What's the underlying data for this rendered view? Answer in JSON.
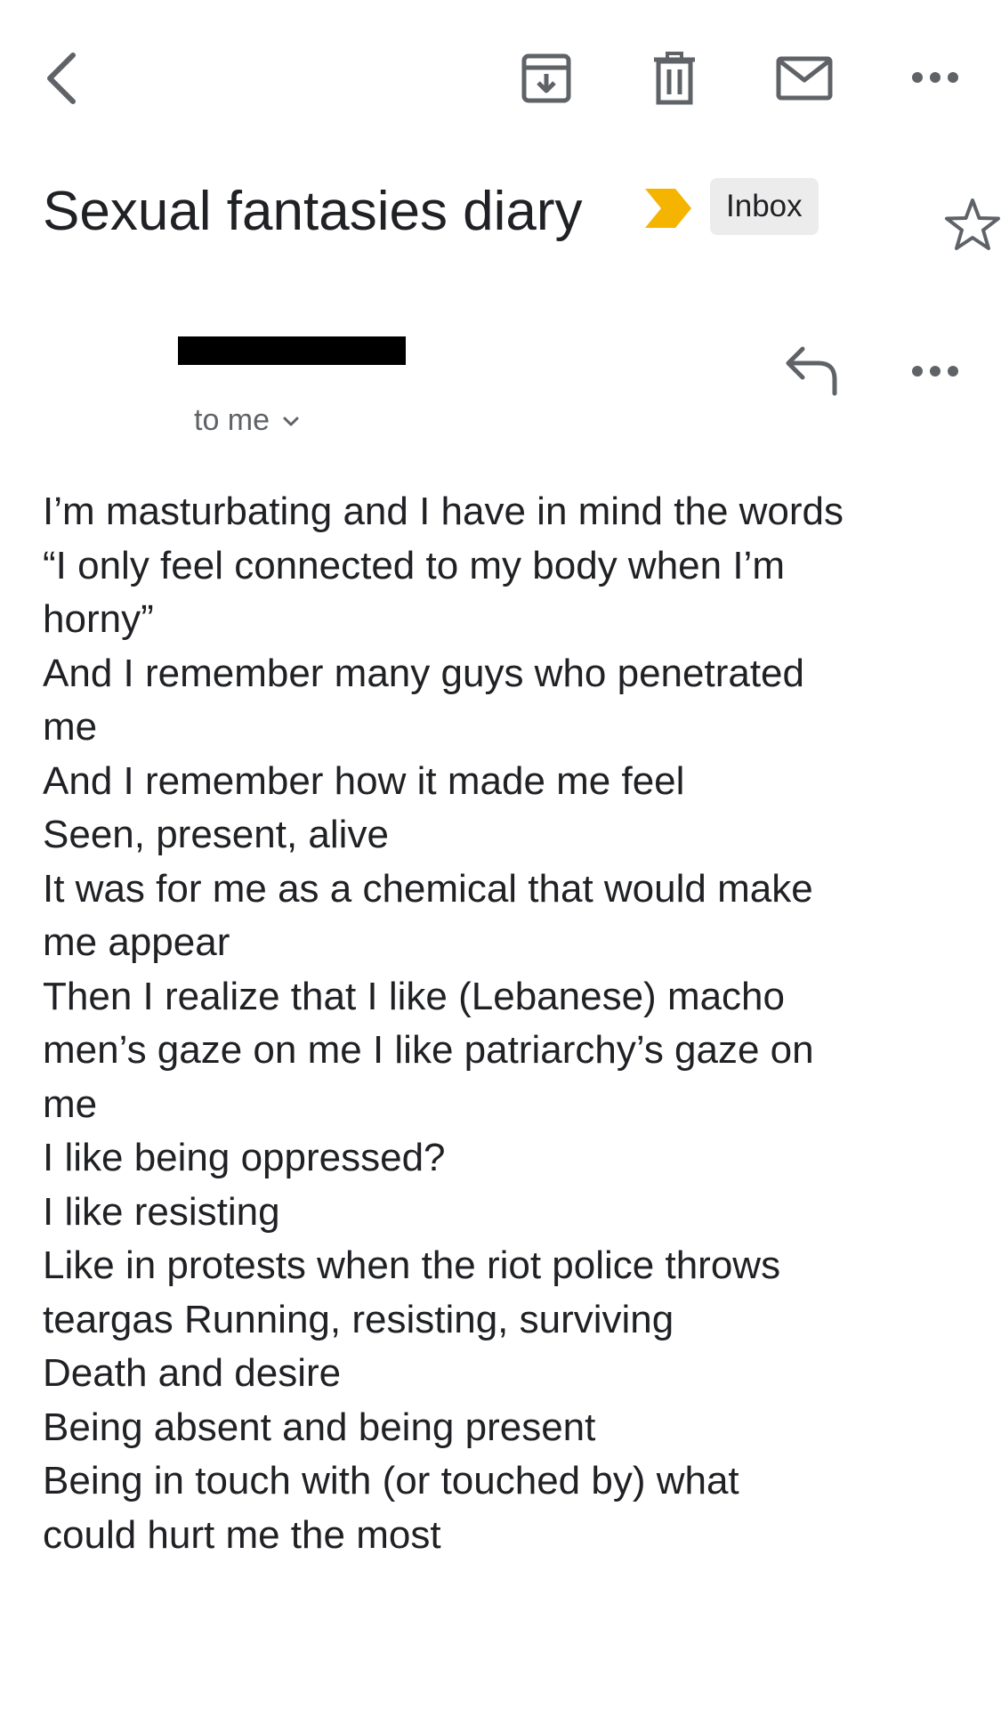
{
  "toolbar": {
    "back_icon": "chevron-left-icon",
    "archive_icon": "archive-icon",
    "delete_icon": "trash-icon",
    "mail_icon": "mail-icon",
    "more_icon": "more-horizontal-icon"
  },
  "email": {
    "subject": "Sexual fantasies diary",
    "importance_marker_color": "#F4B400",
    "label": "Inbox",
    "star_icon": "star-outline-icon",
    "sender_redacted": true,
    "recipient": "to me",
    "recipient_chevron_icon": "chevron-down-icon",
    "reply_icon": "reply-icon",
    "more_icon": "more-horizontal-icon",
    "body_lines": [
      "I’m masturbating and I have in mind the words",
      "“I only feel connected to my body when I’m",
      "horny”",
      "And I remember many guys who penetrated",
      "me",
      "And I remember how it made me feel",
      "Seen, present, alive",
      "It was for me as a chemical that would make",
      "me appear",
      "Then I realize that I like (Lebanese) macho",
      "men’s gaze on me I like patriarchy’s gaze on",
      "me",
      "I like being oppressed?",
      "I like resisting",
      "Like in protests when the riot police throws",
      "teargas Running, resisting, surviving",
      "Death and desire",
      "Being absent and being present",
      "Being in touch with (or touched by) what",
      "could hurt me the most"
    ]
  },
  "colors": {
    "text": "#202124",
    "secondary_text": "#5f6368",
    "icon": "#5f6368",
    "chip_background": "#ececec",
    "redaction": "#000000"
  }
}
